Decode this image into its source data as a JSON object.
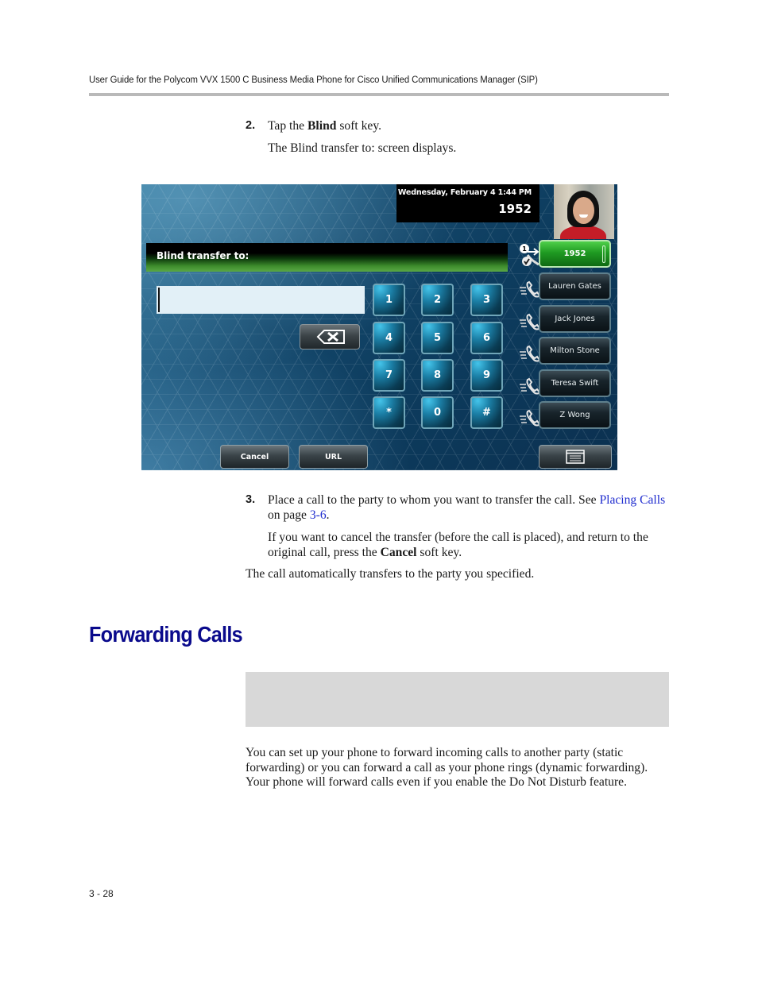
{
  "running_head": "User Guide for the Polycom VVX 1500 C Business Media Phone for Cisco Unified Communications Manager (SIP)",
  "steps": {
    "step2": {
      "number": "2.",
      "text_before": "Tap the ",
      "bold": "Blind",
      "text_after": " soft key.",
      "result": "The Blind transfer to: screen displays."
    },
    "step3": {
      "number": "3.",
      "text": "Place a call to the party to whom you want to transfer the call. See ",
      "link_text": "Placing Calls",
      "mid_text": " on page ",
      "page_link": "3-6",
      "end": ".",
      "cancel_before": "If you want to cancel the transfer (before the call is placed), and return to the original call, press the ",
      "cancel_bold": "Cancel",
      "cancel_after": " soft key."
    },
    "conclusion": "The call automatically transfers to the party you specified."
  },
  "phone_screen": {
    "datetime": "Wednesday, February 4  1:44 PM",
    "extension": "1952",
    "title": "Blind transfer to:",
    "dial_input_value": "",
    "keypad": [
      "1",
      "2",
      "3",
      "4",
      "5",
      "6",
      "7",
      "8",
      "9",
      "*",
      "0",
      "#"
    ],
    "lines": [
      {
        "label": "1952",
        "active": true,
        "icon": "call-transfer-icon",
        "badge": "1"
      },
      {
        "label": "Lauren Gates",
        "active": false,
        "icon": "speed-dial-phone-icon"
      },
      {
        "label": "Jack Jones",
        "active": false,
        "icon": "speed-dial-phone-icon"
      },
      {
        "label": "Milton Stone",
        "active": false,
        "icon": "speed-dial-phone-icon"
      },
      {
        "label": "Teresa Swift",
        "active": false,
        "icon": "speed-dial-phone-icon"
      },
      {
        "label": "Z Wong",
        "active": false,
        "icon": "speed-dial-phone-icon"
      }
    ],
    "softkeys": {
      "cancel": "Cancel",
      "url": "URL",
      "menu_icon": "window-menu-icon"
    },
    "colors": {
      "active_line": "#2aa52a",
      "title_gradient_end": "#5aa845",
      "keypad_blue": "#1b7fa6"
    }
  },
  "section": {
    "heading": "Forwarding Calls",
    "heading_color": "#0a0a8c",
    "paragraph": "You can set up your phone to forward incoming calls to another party (static forwarding) or you can forward a call as your phone rings (dynamic forwarding). Your phone will forward calls even if you enable the Do Not Disturb feature."
  },
  "folio": "3 - 28"
}
